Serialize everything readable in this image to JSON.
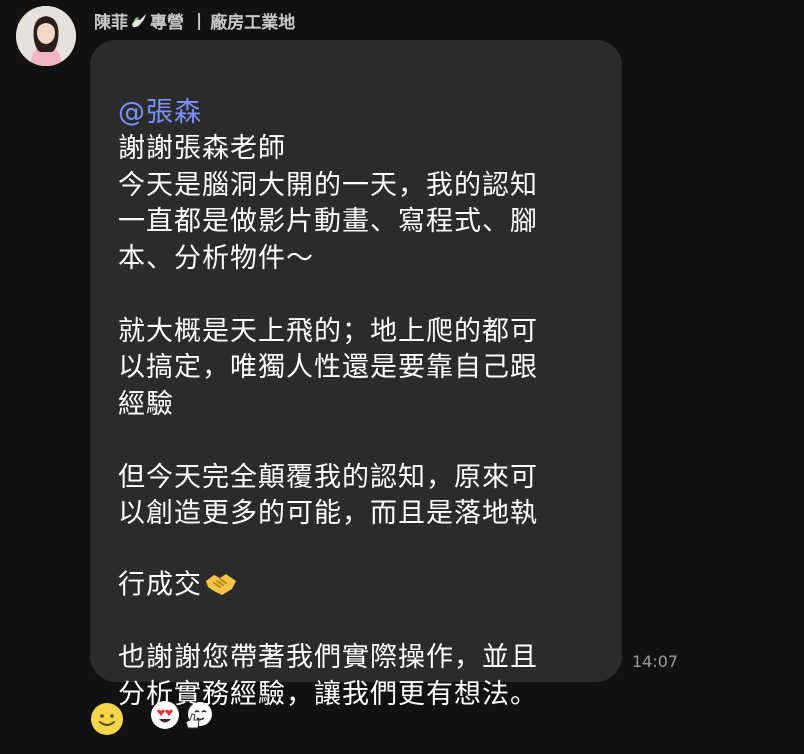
{
  "sender": {
    "name_part1": "陳菲",
    "name_part2": "專營",
    "separator": "|",
    "subtitle": "廠房工業地"
  },
  "message": {
    "mention": "@張森",
    "body": "謝謝張森老師\n今天是腦洞大開的一天，我的認知\n一直都是做影片動畫、寫程式、腳\n本、分析物件～\n\n就大概是天上飛的；地上爬的都可\n以搞定，唯獨人性還是要靠自己跟\n經驗\n\n但今天完全顛覆我的認知，原來可\n以創造更多的可能，而且是落地執\n行成交",
    "body_end": "\n\n也謝謝您帶著我們實際操作，並且\n分析實務經驗，讓我們更有想法。",
    "inline_emoji": "handshake-emoji",
    "time": "14:07"
  },
  "reactions": {
    "add_icon": "smiley-icon",
    "items": [
      "heart-eyes-emoji",
      "thumbs-up-face-emoji"
    ]
  },
  "colors": {
    "background": "#111111",
    "bubble": "#2b2b2b",
    "mention": "#7b90ff",
    "time": "#9a9a9a",
    "emoji_yellow": "#f5c643"
  }
}
